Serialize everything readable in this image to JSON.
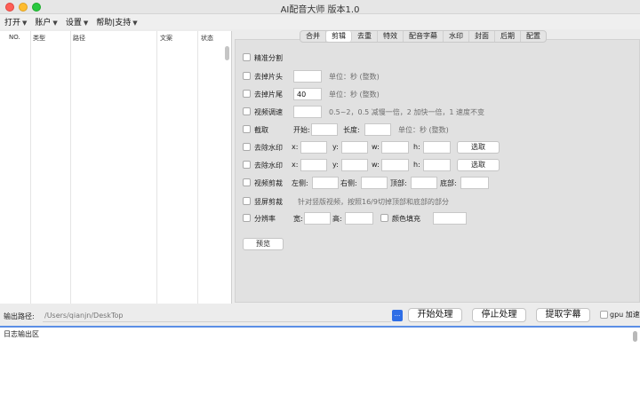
{
  "window": {
    "title": "AI配音大师 版本1.0"
  },
  "menu": [
    {
      "label": "打开",
      "arrow": "▼"
    },
    {
      "label": "账户",
      "arrow": "▼"
    },
    {
      "label": "设置",
      "arrow": "▼"
    },
    {
      "label": "帮助|支持",
      "arrow": "▼"
    }
  ],
  "table": {
    "headers": [
      "NO.",
      "类型",
      "路径",
      "文案",
      "状态"
    ]
  },
  "tabs": [
    {
      "label": "合并",
      "active": false
    },
    {
      "label": "剪辑",
      "active": true
    },
    {
      "label": "去重",
      "active": false
    },
    {
      "label": "特效",
      "active": false
    },
    {
      "label": "配音字幕",
      "active": false
    },
    {
      "label": "水印",
      "active": false
    },
    {
      "label": "封面",
      "active": false
    },
    {
      "label": "后期",
      "active": false
    },
    {
      "label": "配置",
      "active": false
    }
  ],
  "options": {
    "precise_split": "精准分割",
    "trim_head": {
      "label": "去掉片头",
      "value": "",
      "unit": "单位：秒 (整数)"
    },
    "trim_tail": {
      "label": "去掉片尾",
      "value": "40",
      "unit": "单位：秒 (整数)"
    },
    "speed": {
      "label": "视频调速",
      "value": "",
      "hint": "0.5~2，0.5 减慢一倍，2 加快一倍，1 速度不变"
    },
    "cut": {
      "label": "截取",
      "start_label": "开始:",
      "length_label": "长度:",
      "unit": "单位：秒 (整数)"
    },
    "watermark1": {
      "label": "去除水印",
      "x": "x:",
      "y": "y:",
      "w": "w:",
      "h": "h:",
      "button": "选取"
    },
    "watermark2": {
      "label": "去除水印",
      "x": "x:",
      "y": "y:",
      "w": "w:",
      "h": "h:",
      "button": "选取"
    },
    "crop": {
      "label": "视频剪裁",
      "left": "左侧:",
      "right": "右侧:",
      "top": "顶部:",
      "bottom": "底部:"
    },
    "vertical_crop": {
      "label": "竖屏剪裁",
      "hint": "针对竖版视频，按照16/9切掉顶部和底部的部分"
    },
    "resolution": {
      "label": "分辨率",
      "width": "宽:",
      "height": "高:",
      "fill": "颜色填充"
    },
    "preview": "预览"
  },
  "bottom": {
    "output_label": "输出路径:",
    "output_path": "/Users/qianjn/DeskTop",
    "browse": "...",
    "start": "开始处理",
    "stop": "停止处理",
    "extract": "提取字幕",
    "gpu": "gpu 加速"
  },
  "log": {
    "label": "日志输出区"
  }
}
